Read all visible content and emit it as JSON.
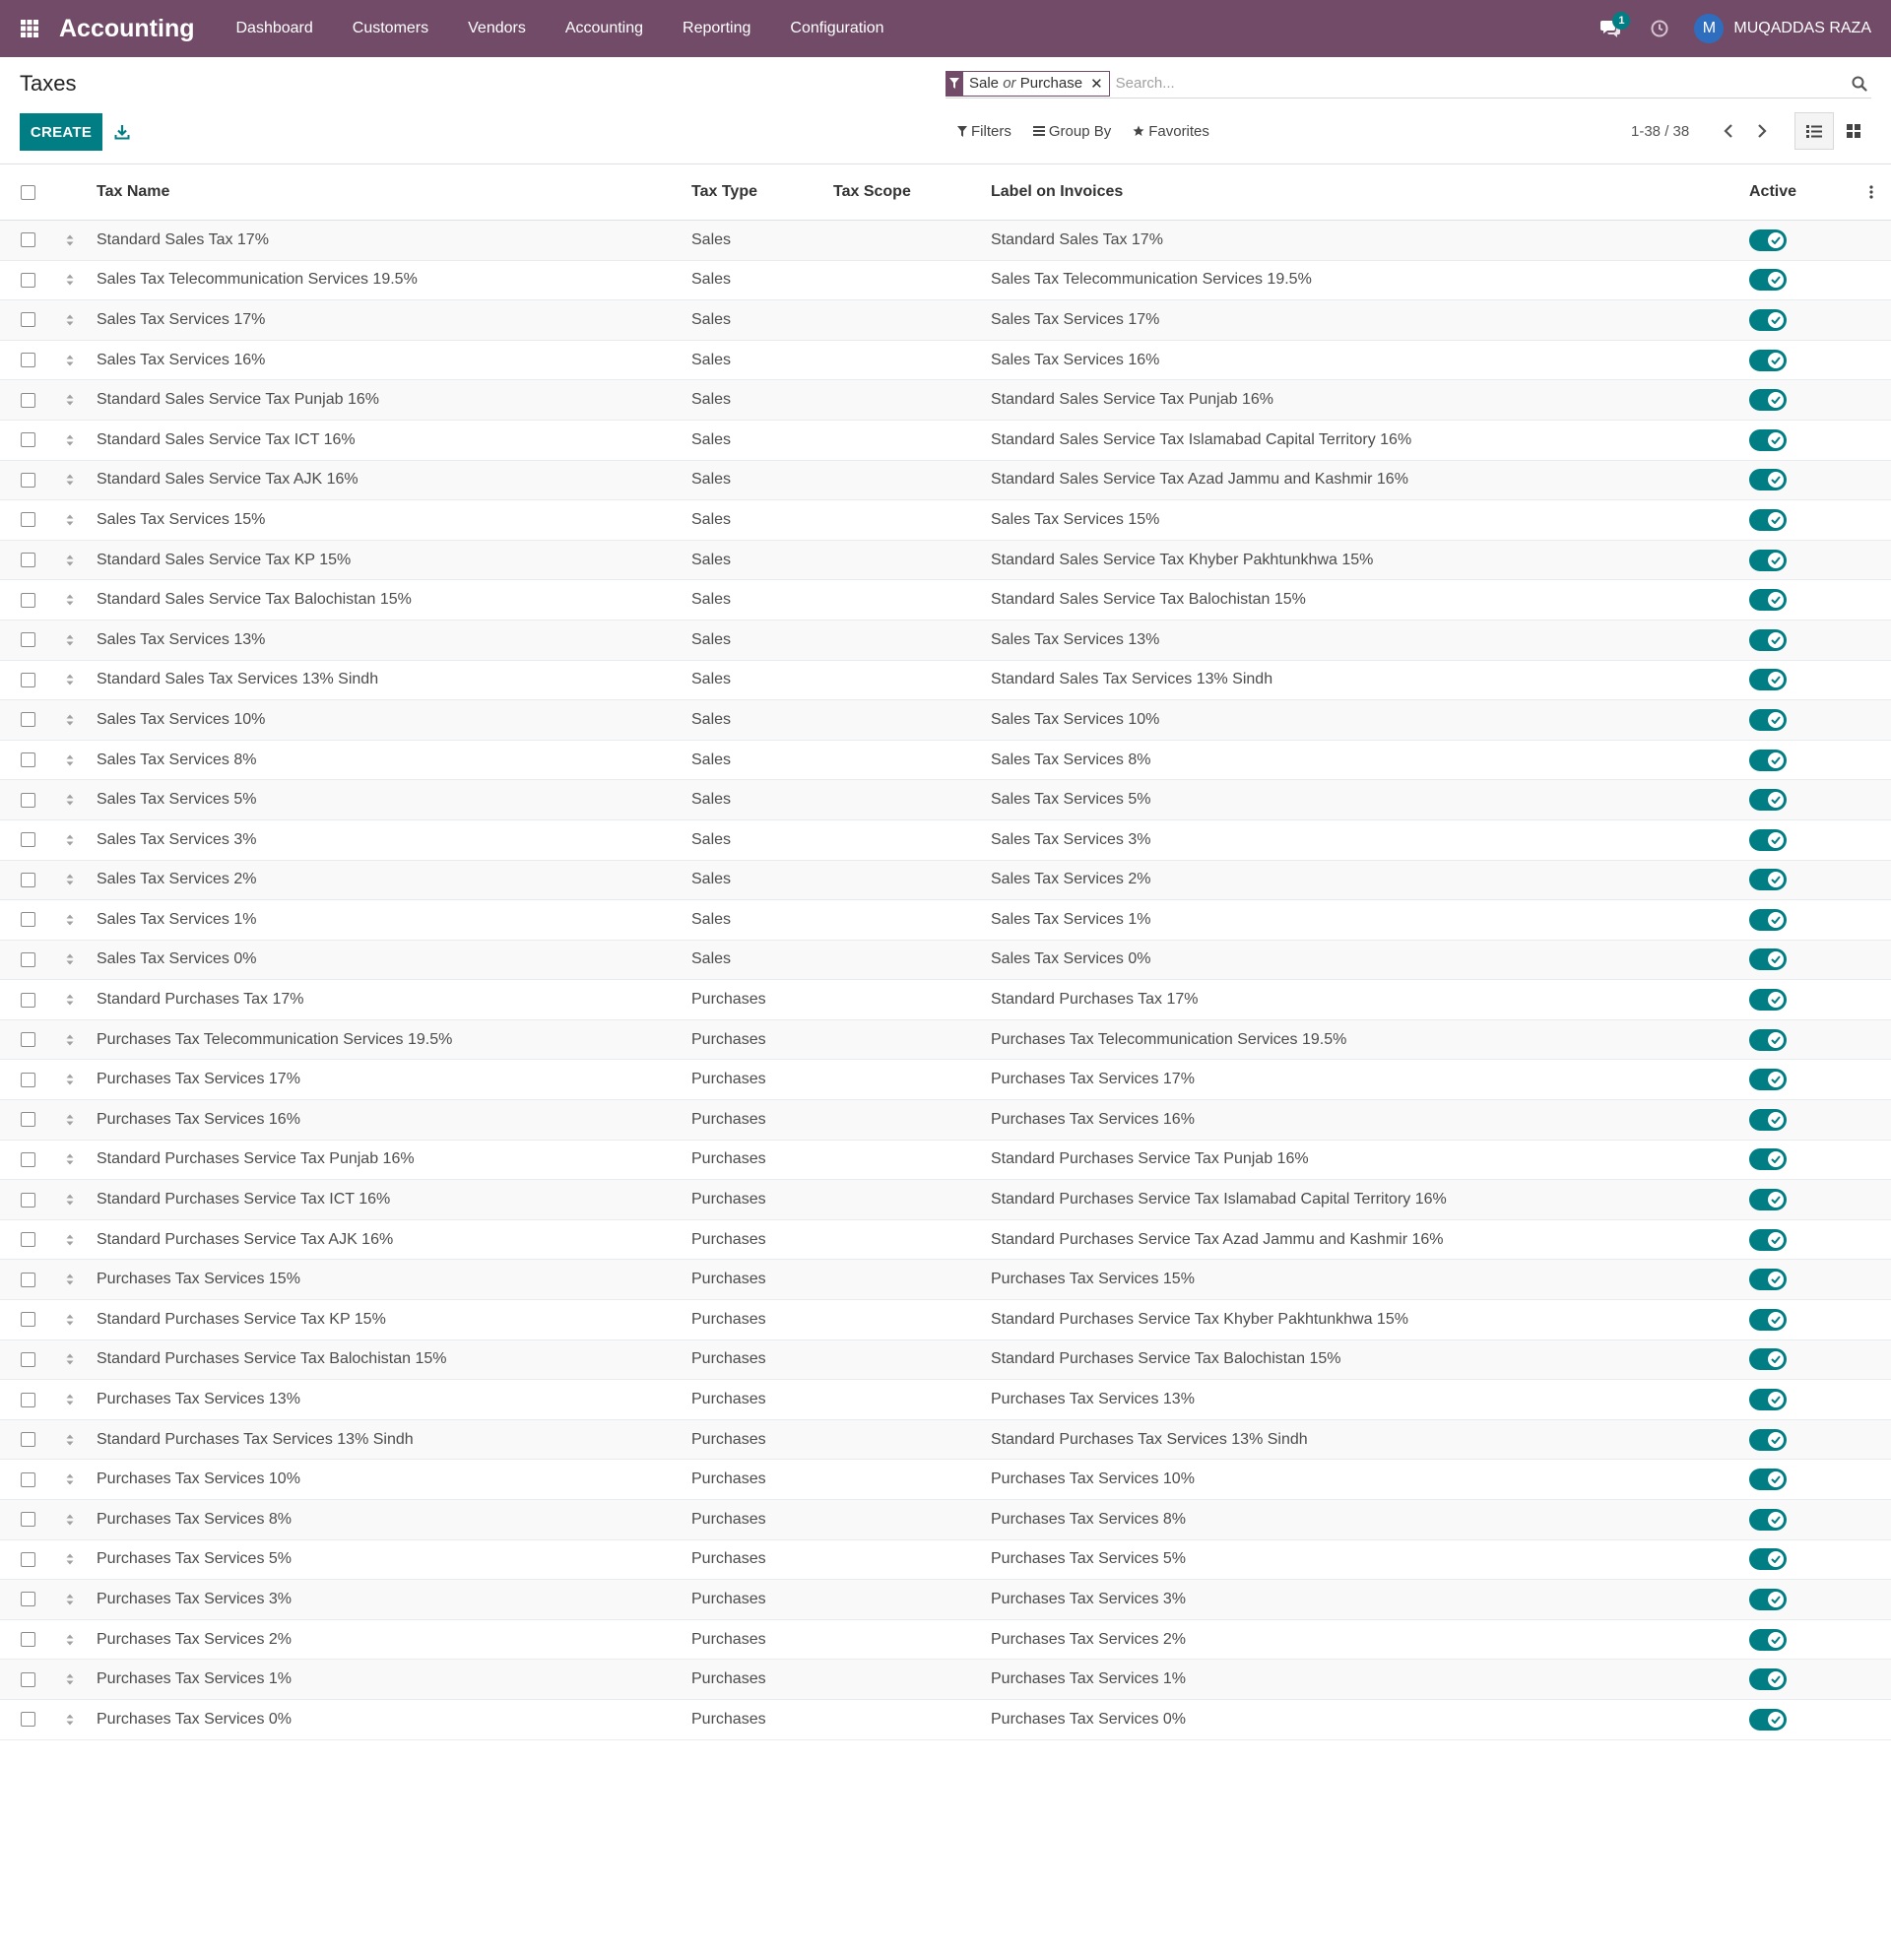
{
  "navbar": {
    "app_title": "Accounting",
    "menu": [
      "Dashboard",
      "Customers",
      "Vendors",
      "Accounting",
      "Reporting",
      "Configuration"
    ],
    "chat_badge": "1",
    "user_initial": "M",
    "user_name": "MUQADDAS RAZA",
    "colors": {
      "bar": "#714b67",
      "avatar": "#2f6dbf",
      "badge": "#017e84"
    }
  },
  "control_panel": {
    "title": "Taxes",
    "create_label": "CREATE",
    "search": {
      "facet_part1": "Sale",
      "facet_or": "or",
      "facet_part2": "Purchase",
      "placeholder": "Search..."
    },
    "filters_label": "Filters",
    "group_by_label": "Group By",
    "favorites_label": "Favorites",
    "pager": "1-38 / 38"
  },
  "table": {
    "headers": {
      "name": "Tax Name",
      "type": "Tax Type",
      "scope": "Tax Scope",
      "label": "Label on Invoices",
      "active": "Active"
    },
    "active_color": "#017e84",
    "rows": [
      {
        "name": "Standard Sales Tax 17%",
        "type": "Sales",
        "scope": "",
        "label": "Standard Sales Tax 17%",
        "active": true
      },
      {
        "name": "Sales Tax Telecommunication Services 19.5%",
        "type": "Sales",
        "scope": "",
        "label": "Sales Tax Telecommunication Services 19.5%",
        "active": true
      },
      {
        "name": "Sales Tax Services 17%",
        "type": "Sales",
        "scope": "",
        "label": "Sales Tax Services 17%",
        "active": true
      },
      {
        "name": "Sales Tax Services 16%",
        "type": "Sales",
        "scope": "",
        "label": "Sales Tax Services 16%",
        "active": true
      },
      {
        "name": "Standard Sales Service Tax Punjab 16%",
        "type": "Sales",
        "scope": "",
        "label": "Standard Sales Service Tax Punjab 16%",
        "active": true
      },
      {
        "name": "Standard Sales Service Tax ICT 16%",
        "type": "Sales",
        "scope": "",
        "label": "Standard Sales Service Tax Islamabad Capital Territory 16%",
        "active": true
      },
      {
        "name": "Standard Sales Service Tax AJK 16%",
        "type": "Sales",
        "scope": "",
        "label": "Standard Sales Service Tax Azad Jammu and Kashmir 16%",
        "active": true
      },
      {
        "name": "Sales Tax Services 15%",
        "type": "Sales",
        "scope": "",
        "label": "Sales Tax Services 15%",
        "active": true
      },
      {
        "name": "Standard Sales Service Tax KP 15%",
        "type": "Sales",
        "scope": "",
        "label": "Standard Sales Service Tax Khyber Pakhtunkhwa 15%",
        "active": true
      },
      {
        "name": "Standard Sales Service Tax Balochistan 15%",
        "type": "Sales",
        "scope": "",
        "label": "Standard Sales Service Tax Balochistan 15%",
        "active": true
      },
      {
        "name": "Sales Tax Services 13%",
        "type": "Sales",
        "scope": "",
        "label": "Sales Tax Services 13%",
        "active": true
      },
      {
        "name": "Standard Sales Tax Services 13% Sindh",
        "type": "Sales",
        "scope": "",
        "label": "Standard Sales Tax Services 13% Sindh",
        "active": true
      },
      {
        "name": "Sales Tax Services 10%",
        "type": "Sales",
        "scope": "",
        "label": "Sales Tax Services 10%",
        "active": true
      },
      {
        "name": "Sales Tax Services 8%",
        "type": "Sales",
        "scope": "",
        "label": "Sales Tax Services 8%",
        "active": true
      },
      {
        "name": "Sales Tax Services 5%",
        "type": "Sales",
        "scope": "",
        "label": "Sales Tax Services 5%",
        "active": true
      },
      {
        "name": "Sales Tax Services 3%",
        "type": "Sales",
        "scope": "",
        "label": "Sales Tax Services 3%",
        "active": true
      },
      {
        "name": "Sales Tax Services 2%",
        "type": "Sales",
        "scope": "",
        "label": "Sales Tax Services 2%",
        "active": true
      },
      {
        "name": "Sales Tax Services 1%",
        "type": "Sales",
        "scope": "",
        "label": "Sales Tax Services 1%",
        "active": true
      },
      {
        "name": "Sales Tax Services 0%",
        "type": "Sales",
        "scope": "",
        "label": "Sales Tax Services 0%",
        "active": true
      },
      {
        "name": "Standard Purchases Tax 17%",
        "type": "Purchases",
        "scope": "",
        "label": "Standard Purchases Tax 17%",
        "active": true
      },
      {
        "name": "Purchases Tax Telecommunication Services 19.5%",
        "type": "Purchases",
        "scope": "",
        "label": "Purchases Tax Telecommunication Services 19.5%",
        "active": true
      },
      {
        "name": "Purchases Tax Services 17%",
        "type": "Purchases",
        "scope": "",
        "label": "Purchases Tax Services 17%",
        "active": true
      },
      {
        "name": "Purchases Tax Services 16%",
        "type": "Purchases",
        "scope": "",
        "label": "Purchases Tax Services 16%",
        "active": true
      },
      {
        "name": "Standard Purchases Service Tax Punjab 16%",
        "type": "Purchases",
        "scope": "",
        "label": "Standard Purchases Service Tax Punjab 16%",
        "active": true
      },
      {
        "name": "Standard Purchases Service Tax ICT 16%",
        "type": "Purchases",
        "scope": "",
        "label": "Standard Purchases Service Tax Islamabad Capital Territory 16%",
        "active": true
      },
      {
        "name": "Standard Purchases Service Tax AJK 16%",
        "type": "Purchases",
        "scope": "",
        "label": "Standard Purchases Service Tax Azad Jammu and Kashmir 16%",
        "active": true
      },
      {
        "name": "Purchases Tax Services 15%",
        "type": "Purchases",
        "scope": "",
        "label": "Purchases Tax Services 15%",
        "active": true
      },
      {
        "name": "Standard Purchases Service Tax KP 15%",
        "type": "Purchases",
        "scope": "",
        "label": "Standard Purchases Service Tax Khyber Pakhtunkhwa 15%",
        "active": true
      },
      {
        "name": "Standard Purchases Service Tax Balochistan 15%",
        "type": "Purchases",
        "scope": "",
        "label": "Standard Purchases Service Tax Balochistan 15%",
        "active": true
      },
      {
        "name": "Purchases Tax Services 13%",
        "type": "Purchases",
        "scope": "",
        "label": "Purchases Tax Services 13%",
        "active": true
      },
      {
        "name": "Standard Purchases Tax Services 13% Sindh",
        "type": "Purchases",
        "scope": "",
        "label": "Standard Purchases Tax Services 13% Sindh",
        "active": true
      },
      {
        "name": "Purchases Tax Services 10%",
        "type": "Purchases",
        "scope": "",
        "label": "Purchases Tax Services 10%",
        "active": true
      },
      {
        "name": "Purchases Tax Services 8%",
        "type": "Purchases",
        "scope": "",
        "label": "Purchases Tax Services 8%",
        "active": true
      },
      {
        "name": "Purchases Tax Services 5%",
        "type": "Purchases",
        "scope": "",
        "label": "Purchases Tax Services 5%",
        "active": true
      },
      {
        "name": "Purchases Tax Services 3%",
        "type": "Purchases",
        "scope": "",
        "label": "Purchases Tax Services 3%",
        "active": true
      },
      {
        "name": "Purchases Tax Services 2%",
        "type": "Purchases",
        "scope": "",
        "label": "Purchases Tax Services 2%",
        "active": true
      },
      {
        "name": "Purchases Tax Services 1%",
        "type": "Purchases",
        "scope": "",
        "label": "Purchases Tax Services 1%",
        "active": true
      },
      {
        "name": "Purchases Tax Services 0%",
        "type": "Purchases",
        "scope": "",
        "label": "Purchases Tax Services 0%",
        "active": true
      }
    ]
  }
}
